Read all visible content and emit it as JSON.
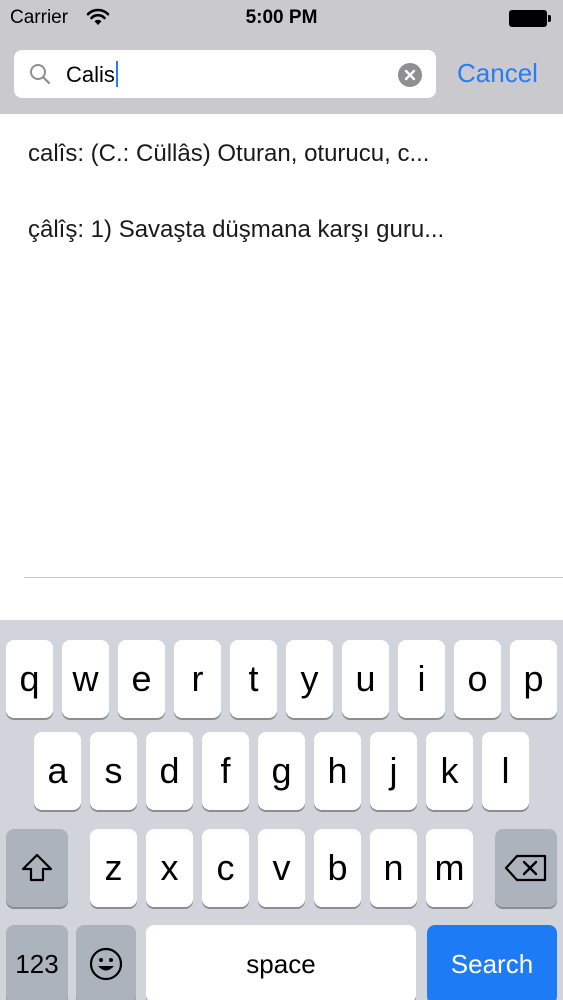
{
  "status_bar": {
    "carrier": "Carrier",
    "time": "5:00 PM",
    "icons": [
      "wifi-icon",
      "battery-icon"
    ]
  },
  "search": {
    "value": "Calis",
    "cancel_label": "Cancel",
    "icons": [
      "search-icon",
      "clear-icon"
    ]
  },
  "results": [
    {
      "text": "calîs: (C.: Cüllâs) Oturan, oturucu, c..."
    },
    {
      "text": "çâlîş: 1) Savaşta düşmana karşı guru..."
    }
  ],
  "keyboard": {
    "row1": [
      "q",
      "w",
      "e",
      "r",
      "t",
      "y",
      "u",
      "i",
      "o",
      "p"
    ],
    "row2": [
      "a",
      "s",
      "d",
      "f",
      "g",
      "h",
      "j",
      "k",
      "l"
    ],
    "row3": [
      "z",
      "x",
      "c",
      "v",
      "b",
      "n",
      "m"
    ],
    "numbers_label": "123",
    "space_label": "space",
    "search_label": "Search",
    "icons": [
      "shift-icon",
      "backspace-icon",
      "emoji-icon"
    ],
    "colors": {
      "accent": "#1e7bf6",
      "key": "#ffffff",
      "dark_key": "#acb3bd",
      "background": "#d1d5db"
    }
  }
}
